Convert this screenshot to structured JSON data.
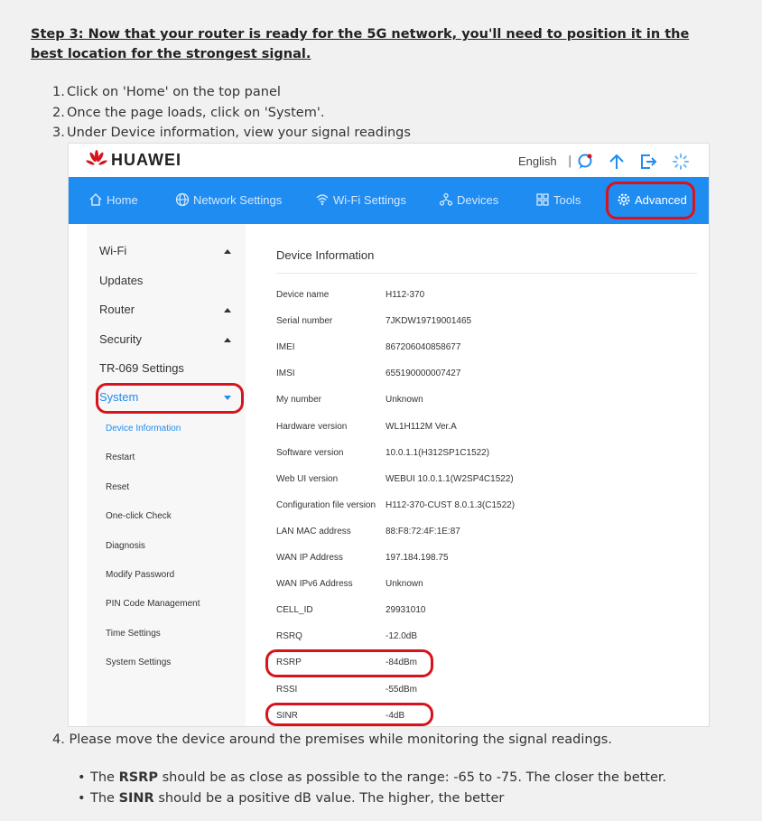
{
  "heading": "Step 3: Now that your router is ready for the 5G network, you'll need to position it in the best location for the strongest signal.",
  "steps": [
    {
      "num": "1.",
      "text": "Click on 'Home' on the top panel"
    },
    {
      "num": "2.",
      "text": "Once the page loads, click on 'System'."
    },
    {
      "num": "3.",
      "text": "Under Device information, view your signal readings"
    }
  ],
  "step4": {
    "num": "4.",
    "text": "Please move the device around the premises while monitoring the signal readings."
  },
  "bullets": [
    {
      "pre": "The ",
      "bold": "RSRP",
      "post": " should be as close as possible to the range: -65 to -75. The closer the better."
    },
    {
      "pre": "The ",
      "bold": "SINR",
      "post": " should be a positive dB value. The higher, the better"
    }
  ],
  "router": {
    "brand": "HUAWEI",
    "language": "English",
    "separator": "|",
    "nav": [
      "Home",
      "Network Settings",
      "Wi-Fi Settings",
      "Devices",
      "Tools",
      "Advanced"
    ],
    "sidebar": [
      "Wi-Fi",
      "Updates",
      "Router",
      "Security",
      "TR-069 Settings",
      "System"
    ],
    "system_sub": [
      "Device Information",
      "Restart",
      "Reset",
      "One-click Check",
      "Diagnosis",
      "Modify Password",
      "PIN Code Management",
      "Time Settings",
      "System Settings"
    ],
    "content_title": "Device Information",
    "rows": [
      {
        "label": "Device name",
        "value": "H112-370"
      },
      {
        "label": "Serial number",
        "value": "7JKDW19719001465"
      },
      {
        "label": "IMEI",
        "value": "867206040858677"
      },
      {
        "label": "IMSI",
        "value": "655190000007427"
      },
      {
        "label": "My number",
        "value": "Unknown"
      },
      {
        "label": "Hardware version",
        "value": "WL1H112M Ver.A"
      },
      {
        "label": "Software version",
        "value": "10.0.1.1(H312SP1C1522)"
      },
      {
        "label": "Web UI version",
        "value": "WEBUI 10.0.1.1(W2SP4C1522)"
      },
      {
        "label": "Configuration file version",
        "value": "H112-370-CUST 8.0.1.3(C1522)"
      },
      {
        "label": "LAN MAC address",
        "value": "88:F8:72:4F:1E:87"
      },
      {
        "label": "WAN IP Address",
        "value": "197.184.198.75"
      },
      {
        "label": "WAN IPv6 Address",
        "value": "Unknown"
      },
      {
        "label": "CELL_ID",
        "value": "29931010"
      },
      {
        "label": "RSRQ",
        "value": "-12.0dB"
      },
      {
        "label": "RSRP",
        "value": "-84dBm"
      },
      {
        "label": "RSSI",
        "value": "-55dBm"
      },
      {
        "label": "SINR",
        "value": "-4dB"
      }
    ]
  },
  "colors": {
    "accent": "#1f8cf2",
    "highlight": "#d7141d",
    "logo": "#d7141d"
  }
}
